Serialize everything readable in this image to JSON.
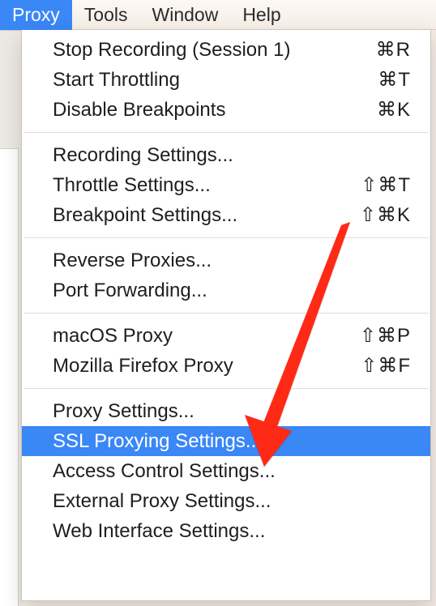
{
  "menubar": {
    "items": [
      {
        "label": "Proxy",
        "active": true
      },
      {
        "label": "Tools",
        "active": false
      },
      {
        "label": "Window",
        "active": false
      },
      {
        "label": "Help",
        "active": false
      }
    ]
  },
  "menu": {
    "groups": [
      [
        {
          "label": "Stop Recording (Session 1)",
          "shortcut": "⌘R"
        },
        {
          "label": "Start Throttling",
          "shortcut": "⌘T"
        },
        {
          "label": "Disable Breakpoints",
          "shortcut": "⌘K"
        }
      ],
      [
        {
          "label": "Recording Settings...",
          "shortcut": ""
        },
        {
          "label": "Throttle Settings...",
          "shortcut": "⇧⌘T"
        },
        {
          "label": "Breakpoint Settings...",
          "shortcut": "⇧⌘K"
        }
      ],
      [
        {
          "label": "Reverse Proxies...",
          "shortcut": ""
        },
        {
          "label": "Port Forwarding...",
          "shortcut": ""
        }
      ],
      [
        {
          "label": "macOS Proxy",
          "shortcut": "⇧⌘P"
        },
        {
          "label": "Mozilla Firefox Proxy",
          "shortcut": "⇧⌘F"
        }
      ],
      [
        {
          "label": "Proxy Settings...",
          "shortcut": ""
        },
        {
          "label": "SSL Proxying Settings...",
          "shortcut": "",
          "highlight": true
        },
        {
          "label": "Access Control Settings...",
          "shortcut": ""
        },
        {
          "label": "External Proxy Settings...",
          "shortcut": ""
        },
        {
          "label": "Web Interface Settings...",
          "shortcut": ""
        }
      ]
    ]
  },
  "annotation": {
    "arrow_color": "#ff2a18"
  }
}
